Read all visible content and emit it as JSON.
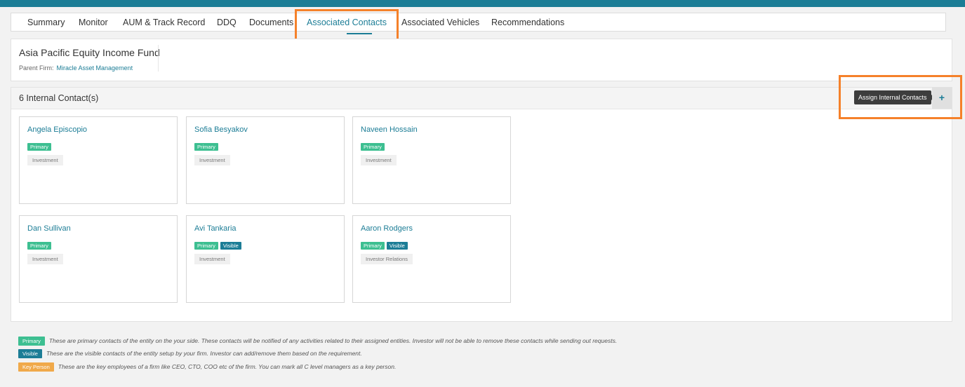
{
  "tabs": [
    {
      "label": "Summary"
    },
    {
      "label": "Monitor"
    },
    {
      "label": "AUM & Track Record"
    },
    {
      "label": "DDQ"
    },
    {
      "label": "Documents"
    },
    {
      "label": "Associated Contacts"
    },
    {
      "label": "Associated Vehicles"
    },
    {
      "label": "Recommendations"
    }
  ],
  "fund": {
    "name": "Asia Pacific Equity Income Fund",
    "parent_label": "Parent Firm:",
    "parent_firm": "Miracle Asset Management"
  },
  "contacts": {
    "title": "6 Internal Contact(s)",
    "assign_tooltip": "Assign Internal Contacts",
    "add_icon": "+",
    "items": [
      {
        "name": "Angela Episcopio",
        "badges": [
          "Primary"
        ],
        "department": "Investment"
      },
      {
        "name": "Sofia Besyakov",
        "badges": [
          "Primary"
        ],
        "department": "Investment"
      },
      {
        "name": "Naveen Hossain",
        "badges": [
          "Primary"
        ],
        "department": "Investment"
      },
      {
        "name": "Dan Sullivan",
        "badges": [
          "Primary"
        ],
        "department": "Investment"
      },
      {
        "name": "Avi Tankaria",
        "badges": [
          "Primary",
          "Visible"
        ],
        "department": "Investment"
      },
      {
        "name": "Aaron Rodgers",
        "badges": [
          "Primary",
          "Visible"
        ],
        "department": "Investor Relations"
      }
    ]
  },
  "legend": [
    {
      "badge": "Primary",
      "text": "These are primary contacts of the entity on the your side. These contacts will be notified of any activities related to their assigned entities. Investor will not be able to remove these contacts while sending out requests."
    },
    {
      "badge": "Visible",
      "text": "These are the visible contacts of the entity setup by your firm. Investor can add/remove them based on the requirement."
    },
    {
      "badge": "Key Person",
      "text": "These are the key employees of a firm like CEO, CTO, COO etc of the firm. You can mark all C level managers as a key person."
    }
  ],
  "colors": {
    "accent": "#1c7d96",
    "primary_badge": "#3dbf91",
    "visible_badge": "#1c7d96",
    "key_person_badge": "#f0a94a",
    "highlight": "#f5812a"
  }
}
